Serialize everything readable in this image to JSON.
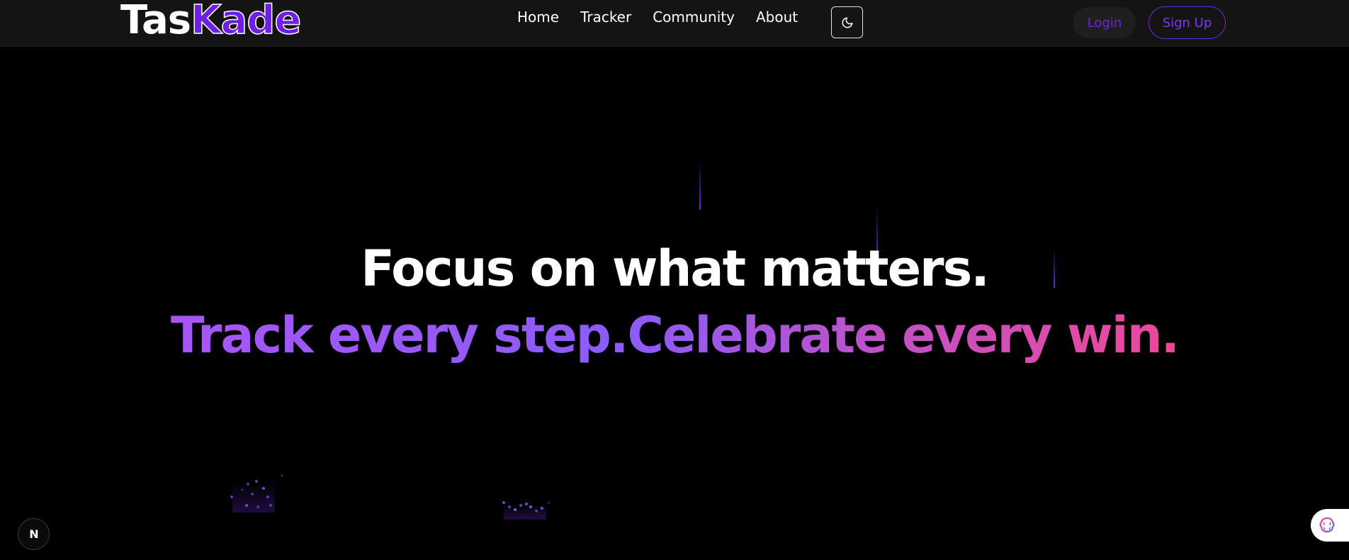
{
  "nav": {
    "logo_part1": "Tas",
    "logo_part2": "Kade",
    "links": [
      "Home",
      "Tracker",
      "Community",
      "About"
    ],
    "theme_toggle_icon": "moon-icon",
    "login_label": "Login",
    "signup_label": "Sign Up"
  },
  "hero": {
    "headline": "Focus on what matters.",
    "subheadline": "Track every step.Celebrate every win."
  },
  "badges": {
    "next_badge_letter": "N",
    "next_badge_icon": "nextjs-icon",
    "extension_icon": "brain-icon"
  },
  "colors": {
    "brand_purple": "#6d1fe6",
    "accent_violet": "#7c3aed",
    "gradient_start": "#a855f7",
    "gradient_end": "#ec4899",
    "background": "#000000",
    "navbar": "#141414"
  }
}
